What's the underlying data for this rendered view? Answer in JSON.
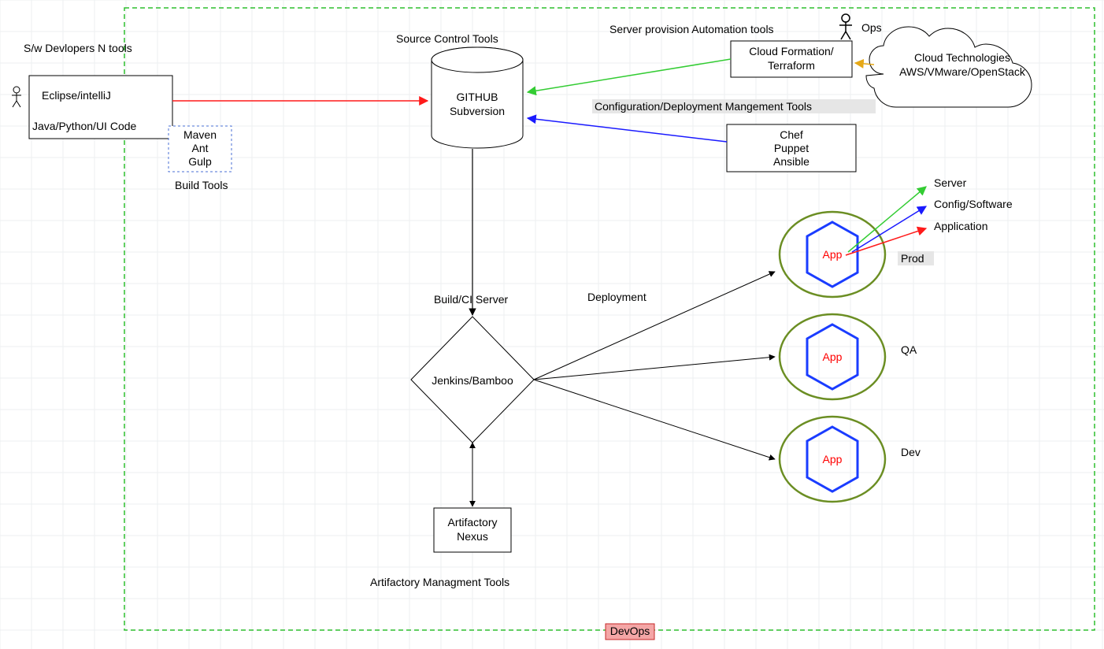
{
  "container": {
    "label": "DevOps"
  },
  "dev": {
    "title": "S/w Devlopers N tools",
    "ide_line1": "Eclipse/intelliJ",
    "ide_line2": "Java/Python/UI Code",
    "build_box_title": "Build Tools",
    "build_tools": [
      "Maven",
      "Ant",
      "Gulp"
    ]
  },
  "ops_actor": "Ops",
  "scm": {
    "title": "Source Control Tools",
    "line1": "GITHUB",
    "line2": "Subversion"
  },
  "provision": {
    "title": "Server provision Automation tools",
    "line1": "Cloud Formation/",
    "line2": "Terraform"
  },
  "cloud": {
    "line1": "Cloud Technologies",
    "line2": "AWS/VMware/OpenStack"
  },
  "config_mgmt": {
    "title": "Configuration/Deployment Mangement Tools",
    "line1": "Chef",
    "line2": "Puppet",
    "line3": "Ansible"
  },
  "ci": {
    "title": "Build/CI Server",
    "label": "Jenkins/Bamboo",
    "deployment_label": "Deployment"
  },
  "artifact": {
    "title": "Artifactory Managment Tools",
    "line1": "Artifactory",
    "line2": "Nexus"
  },
  "envs": {
    "app_label": "App",
    "env1": "Prod",
    "env2": "QA",
    "env3": "Dev"
  },
  "legend": {
    "server": "Server",
    "config": "Config/Software",
    "application": "Application"
  },
  "colors": {
    "arrow_red": "#ff1a1a",
    "arrow_green": "#33cc33",
    "arrow_blue": "#1a1aff",
    "arrow_orange": "#e6a817",
    "hex_blue": "#1a3cff",
    "env_ring": "#6b8e23",
    "devops_fill": "#f4a6a6",
    "devops_stroke": "#c62828",
    "dash_green": "#2fbf2f"
  }
}
